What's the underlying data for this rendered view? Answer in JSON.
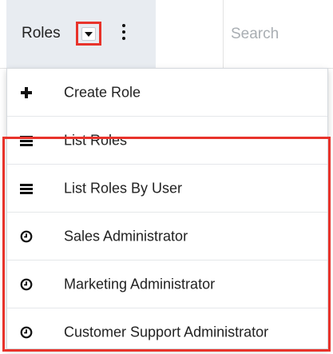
{
  "header": {
    "module_label": "Roles",
    "search_placeholder": "Search"
  },
  "menu": {
    "actions": [
      {
        "label": "Create Role",
        "icon": "plus-icon"
      },
      {
        "label": "List Roles",
        "icon": "list-icon"
      },
      {
        "label": "List Roles By User",
        "icon": "list-icon"
      }
    ],
    "recent": [
      {
        "label": "Sales Administrator",
        "icon": "clock-icon"
      },
      {
        "label": "Marketing Administrator",
        "icon": "clock-icon"
      },
      {
        "label": "Customer Support Administrator",
        "icon": "clock-icon"
      }
    ]
  },
  "colors": {
    "highlight": "#e8332b",
    "tab_background": "#e8ecf1",
    "placeholder": "#a9aeb3"
  }
}
